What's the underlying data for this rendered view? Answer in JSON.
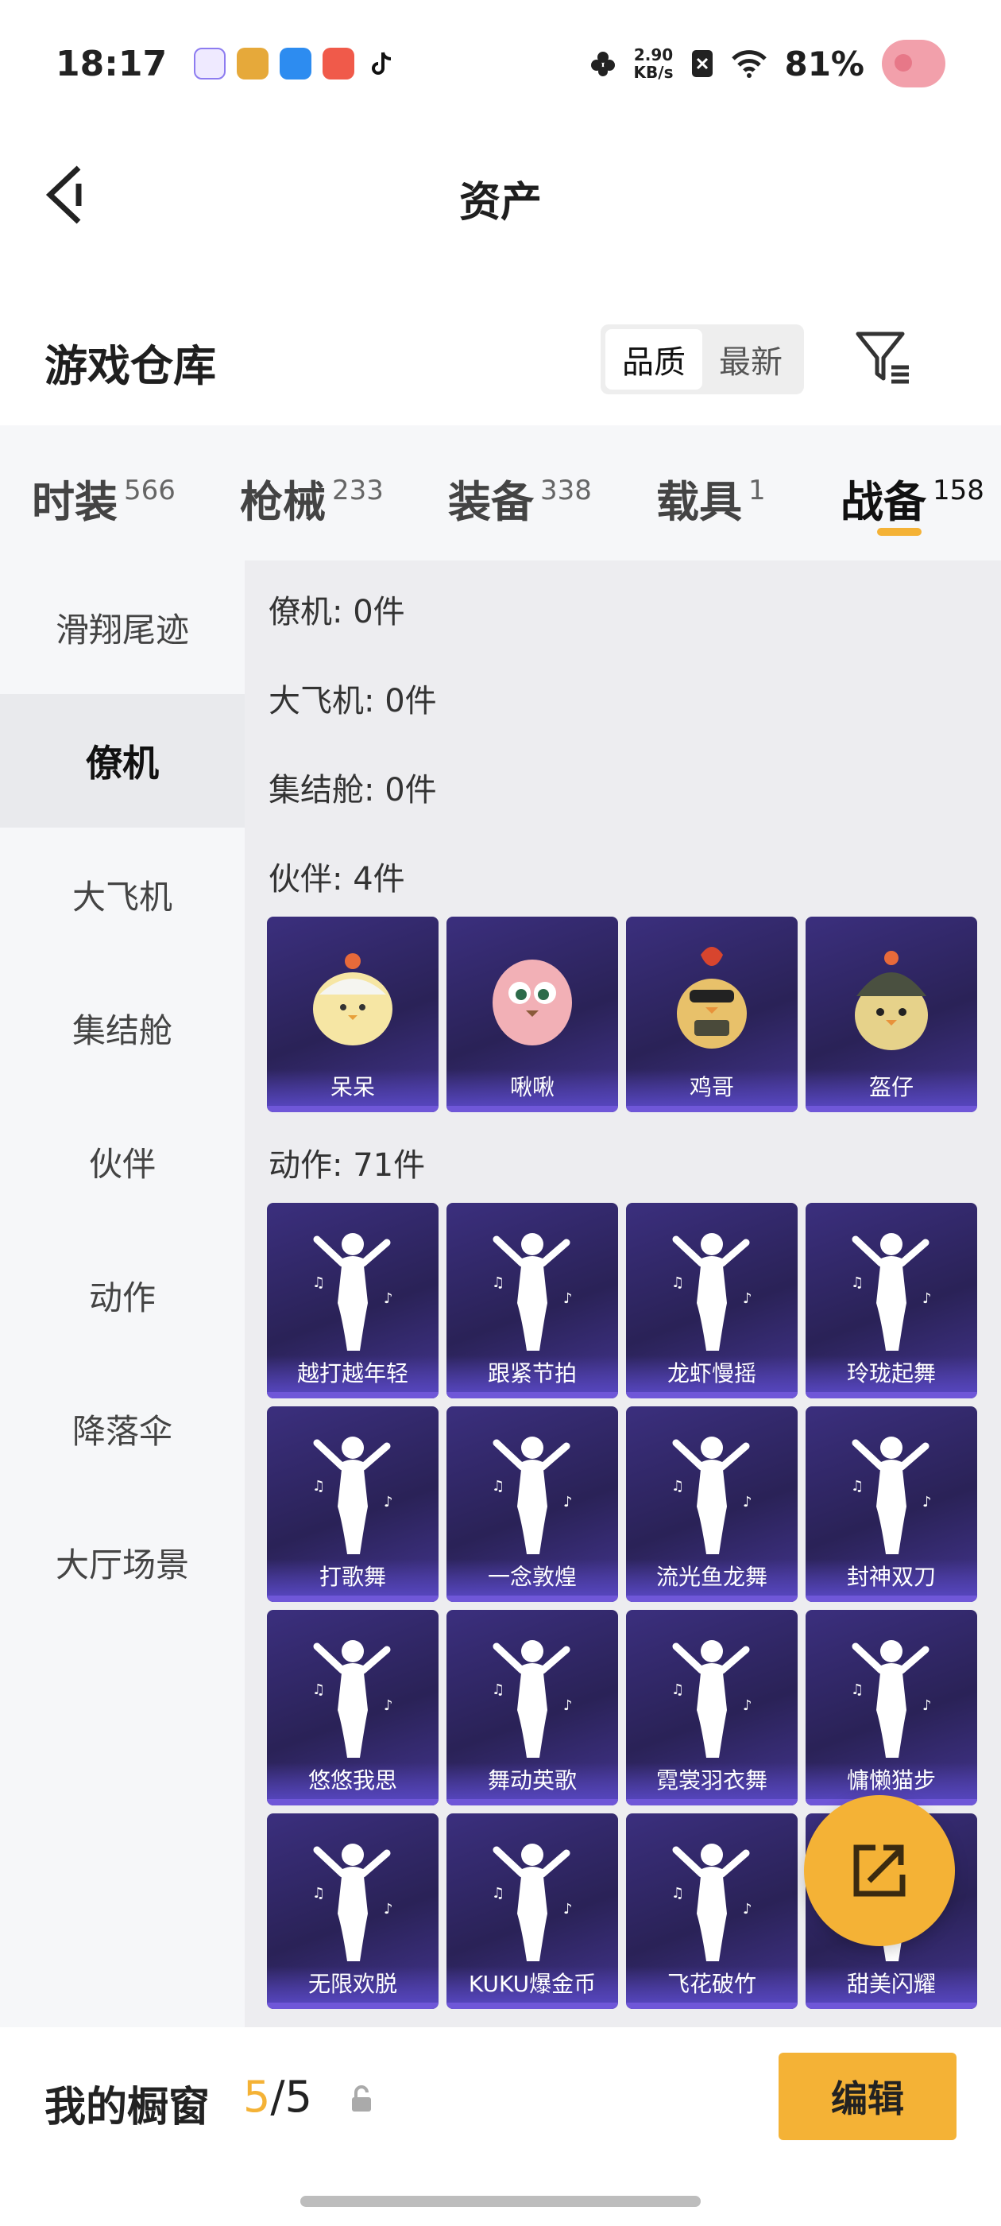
{
  "status_bar": {
    "time": "18:17",
    "net_speed_value": "2.90",
    "net_speed_unit": "KB/s",
    "battery": "81%"
  },
  "header": {
    "title": "资产"
  },
  "warehouse": {
    "title": "游戏仓库",
    "sort_options": [
      "品质",
      "最新"
    ],
    "active_sort": "品质"
  },
  "tabs": [
    {
      "label": "时装",
      "count": "566"
    },
    {
      "label": "枪械",
      "count": "233"
    },
    {
      "label": "装备",
      "count": "338"
    },
    {
      "label": "载具",
      "count": "1"
    },
    {
      "label": "战备",
      "count": "158"
    }
  ],
  "active_tab": "战备",
  "sidebar": {
    "items": [
      "滑翔尾迹",
      "僚机",
      "大飞机",
      "集结舱",
      "伙伴",
      "动作",
      "降落伞",
      "大厅场景"
    ],
    "active": "僚机"
  },
  "sections": {
    "wingman": "僚机: 0件",
    "big_plane": "大飞机: 0件",
    "rally_pod": "集结舱: 0件",
    "partner": "伙伴: 4件",
    "action": "动作: 71件"
  },
  "partners": [
    "呆呆",
    "啾啾",
    "鸡哥",
    "盔仔"
  ],
  "actions": [
    "越打越年轻",
    "跟紧节拍",
    "龙虾慢摇",
    "玲珑起舞",
    "打歌舞",
    "一念敦煌",
    "流光鱼龙舞",
    "封神双刀",
    "悠悠我思",
    "舞动英歌",
    "霓裳羽衣舞",
    "慵懒猫步",
    "无限欢脱",
    "KUKU爆金币",
    "飞花破竹",
    "甜美闪耀"
  ],
  "bottom_bar": {
    "label": "我的橱窗",
    "count_current": "5",
    "count_sep": "/",
    "count_total": "5",
    "edit_label": "编辑"
  },
  "colors": {
    "accent": "#f4b236",
    "card_bg": "#2e2560",
    "card_bar": "#6f57d8"
  }
}
